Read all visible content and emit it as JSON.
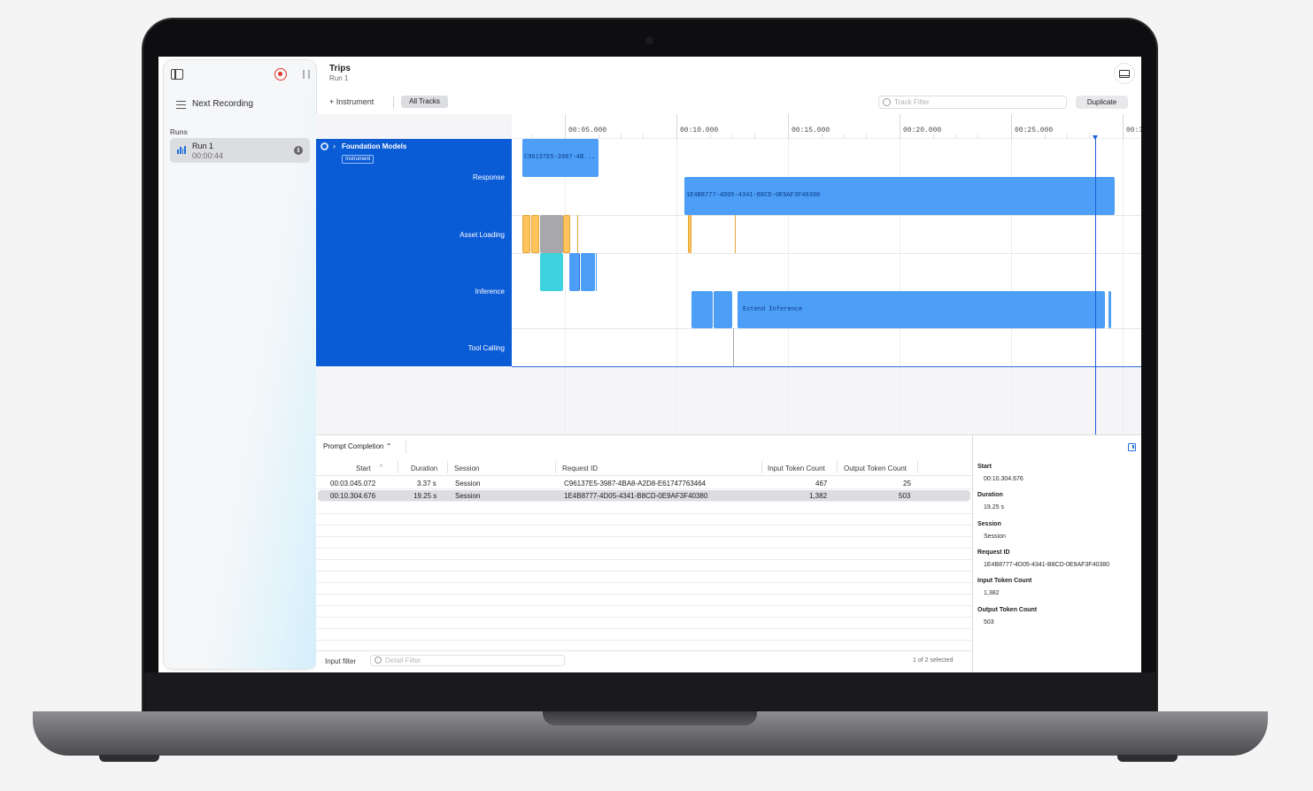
{
  "sidebar": {
    "next_recording": "Next Recording",
    "runs_label": "Runs",
    "run": {
      "name": "Run 1",
      "duration": "00:00:44"
    }
  },
  "header": {
    "title": "Trips",
    "subtitle": "Run 1",
    "instrument_button": "+ Instrument",
    "all_tracks": "All Tracks",
    "track_filter_placeholder": "Track Filter",
    "duplicate": "Duplicate"
  },
  "timeline": {
    "ticks": [
      "00:05.000",
      "00:10.000",
      "00:15.000",
      "00:20.000",
      "00:25.000",
      "00:3"
    ],
    "instrument": {
      "name": "Foundation Models",
      "badge": "Instrument"
    },
    "lanes": [
      "Response",
      "Asset Loading",
      "Inference",
      "Tool Calling"
    ],
    "response_bars": [
      "C96137E5-3987-4B...",
      "1E4B8777-4D05-4341-B8CD-0E9AF3F40380"
    ],
    "inference_label": "Extend Inference"
  },
  "table": {
    "mode": "Prompt Completion ⌃",
    "columns": [
      "Start",
      "Duration",
      "Session",
      "Request ID",
      "Input Token Count",
      "Output Token Count"
    ],
    "sort_indicator": "^",
    "rows": [
      {
        "start": "00:03.045.072",
        "duration": "3.37 s",
        "session": "Session",
        "request_id": "C96137E5-3987-4BA8-A2D8-E61747763464",
        "input_tokens": "467",
        "output_tokens": "25"
      },
      {
        "start": "00:10.304.676",
        "duration": "19.25 s",
        "session": "Session",
        "request_id": "1E4B8777-4D05-4341-B8CD-0E9AF3F40380",
        "input_tokens": "1,382",
        "output_tokens": "503"
      }
    ],
    "selected_row": 1,
    "input_filter_label": "Input filter",
    "detail_filter_placeholder": "Detail Filter",
    "selection_count": "1 of 2 selected"
  },
  "inspector": {
    "fields": [
      {
        "label": "Start",
        "value": "00:10.304.676"
      },
      {
        "label": "Duration",
        "value": "19.25 s"
      },
      {
        "label": "Session",
        "value": "Session"
      },
      {
        "label": "Request ID",
        "value": "1E4B8777-4D05-4341-B8CD-0E9AF3F40380"
      },
      {
        "label": "Input Token Count",
        "value": "1,382"
      },
      {
        "label": "Output Token Count",
        "value": "503"
      }
    ]
  },
  "colors": {
    "accent": "#0a5bd6",
    "bar_blue": "#4d9ef6",
    "bar_gold": "#ffc45b",
    "bar_cyan": "#3dd3de",
    "record_red": "#e0382c"
  }
}
